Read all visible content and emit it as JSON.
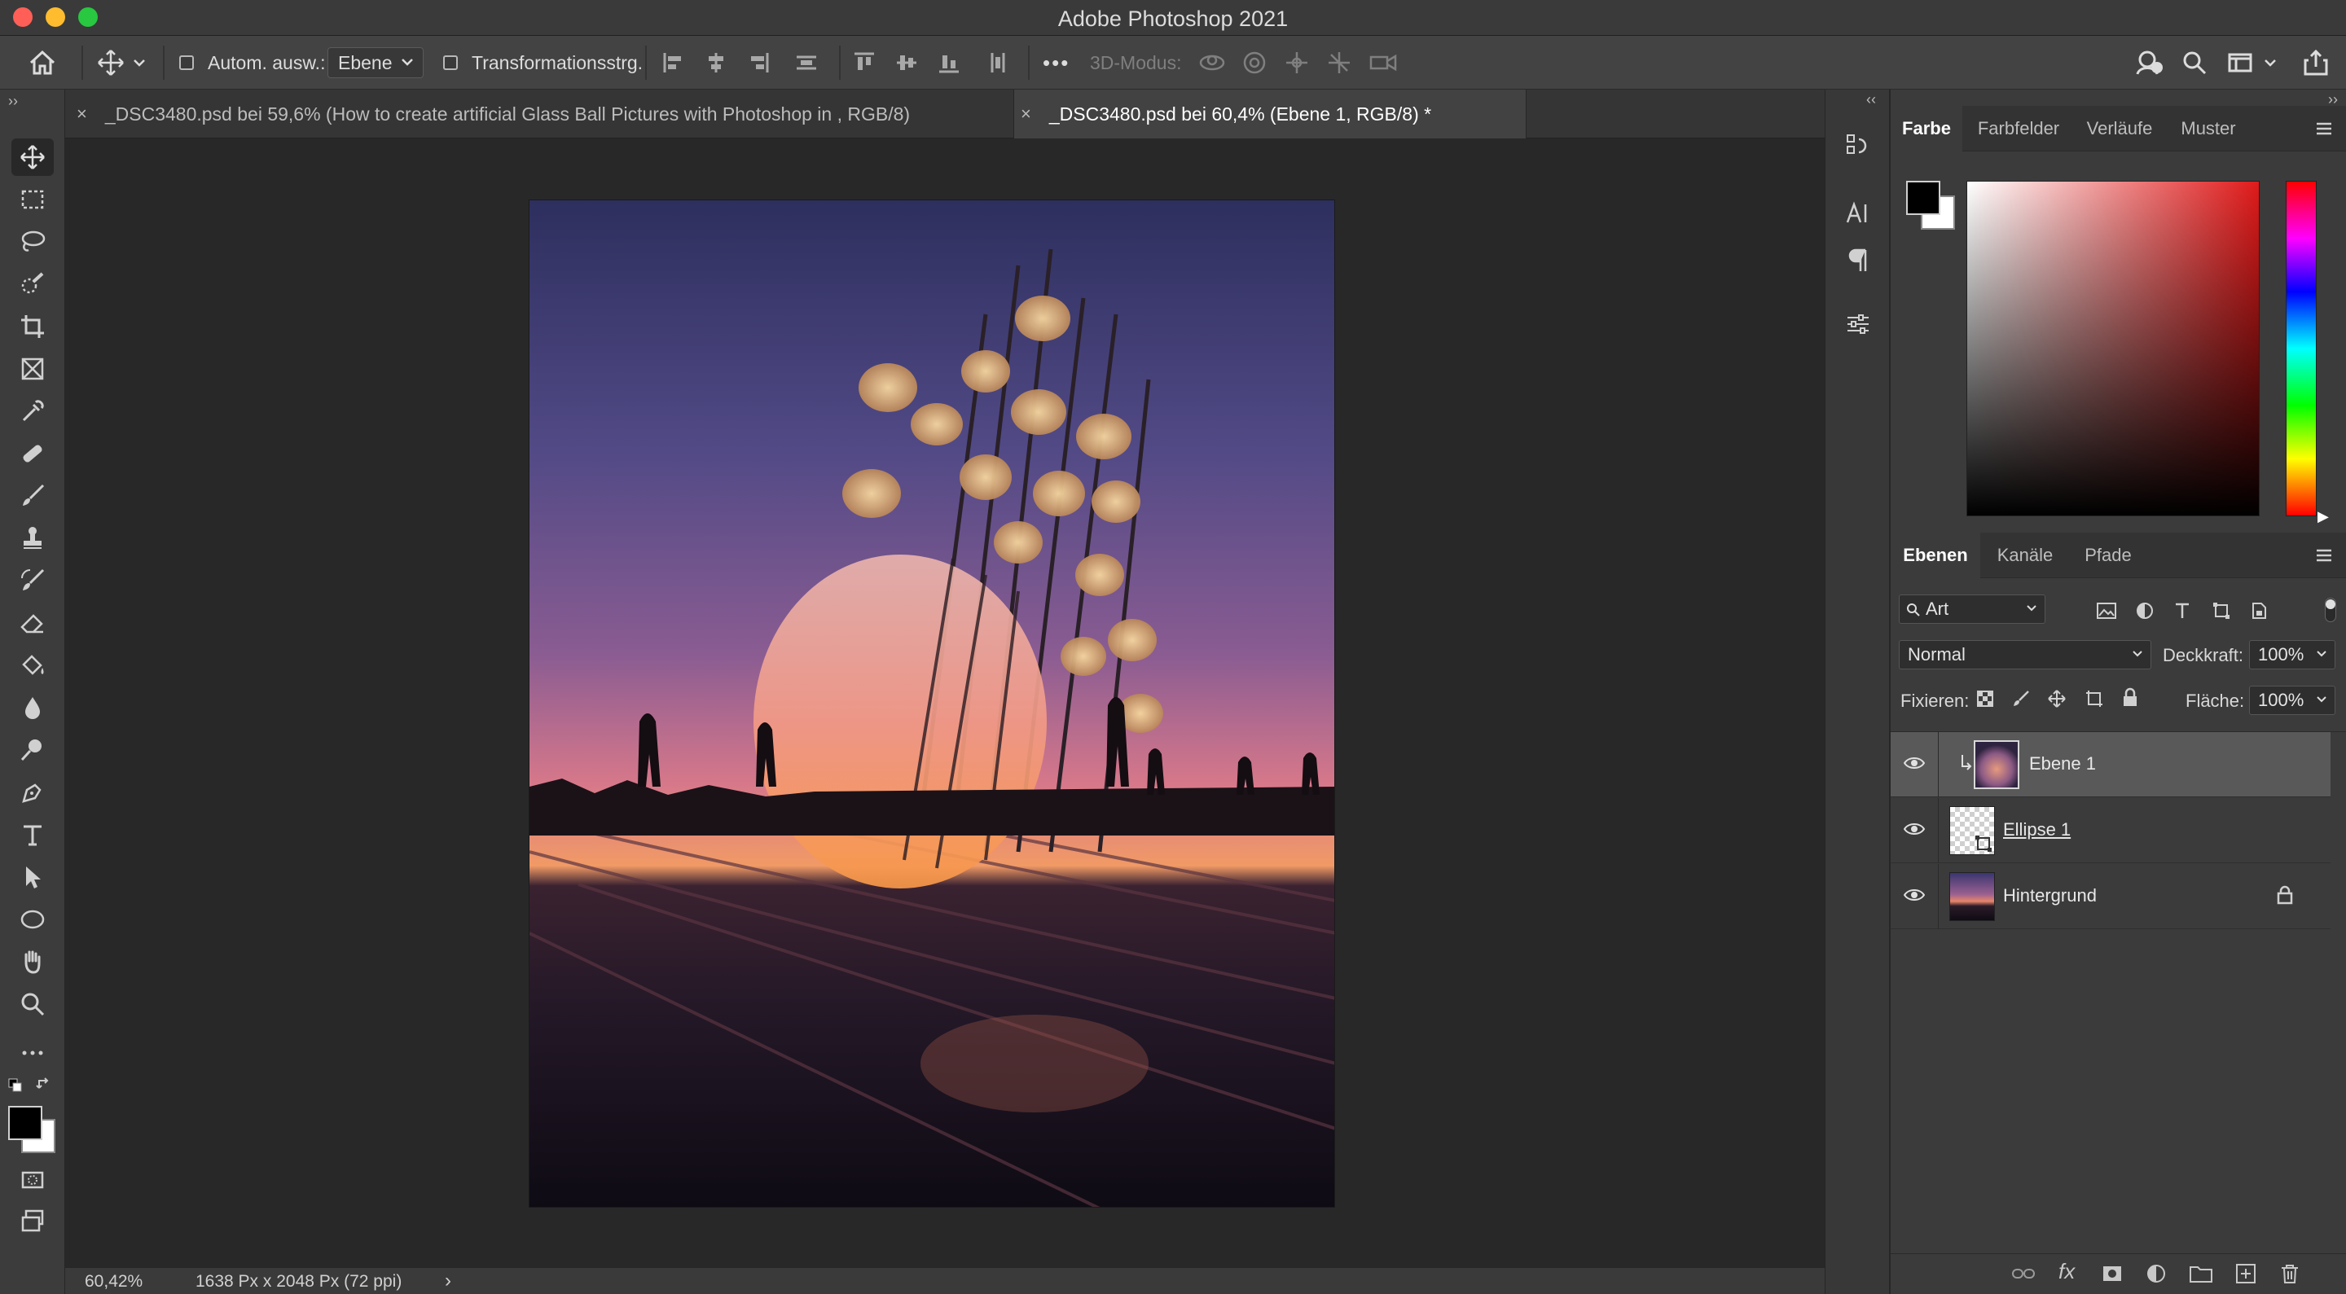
{
  "window": {
    "title": "Adobe Photoshop 2021"
  },
  "options_bar": {
    "auto_select_label": "Autom. ausw.:",
    "auto_select_target": "Ebene",
    "transform_label": "Transformationsstrg.",
    "more": "•••",
    "mode_3d_label": "3D-Modus:"
  },
  "document_tabs": [
    {
      "label": "_DSC3480.psd bei 59,6% (How to create artificial Glass Ball Pictures with Photoshop in , RGB/8)",
      "close": "×",
      "active": false
    },
    {
      "label": "_DSC3480.psd bei 60,4% (Ebene 1, RGB/8) *",
      "close": "×",
      "active": true
    }
  ],
  "tools": [
    {
      "name": "move-tool",
      "icon": "move-icon",
      "active": true
    },
    {
      "name": "marquee-tool",
      "icon": "rect-marquee-icon"
    },
    {
      "name": "lasso-tool",
      "icon": "lasso-icon"
    },
    {
      "name": "quick-select-tool",
      "icon": "quick-select-icon"
    },
    {
      "name": "crop-tool",
      "icon": "crop-icon"
    },
    {
      "name": "frame-tool",
      "icon": "frame-icon"
    },
    {
      "name": "eyedropper-tool",
      "icon": "eyedropper-icon"
    },
    {
      "name": "healing-tool",
      "icon": "bandage-icon"
    },
    {
      "name": "brush-tool",
      "icon": "brush-icon"
    },
    {
      "name": "stamp-tool",
      "icon": "stamp-icon"
    },
    {
      "name": "history-brush-tool",
      "icon": "history-brush-icon"
    },
    {
      "name": "eraser-tool",
      "icon": "eraser-icon"
    },
    {
      "name": "paint-bucket-tool",
      "icon": "paint-bucket-icon"
    },
    {
      "name": "blur-tool",
      "icon": "drop-icon"
    },
    {
      "name": "dodge-tool",
      "icon": "dodge-icon"
    },
    {
      "name": "pen-tool",
      "icon": "pen-icon"
    },
    {
      "name": "type-tool",
      "icon": "type-icon"
    },
    {
      "name": "path-select-tool",
      "icon": "arrow-icon"
    },
    {
      "name": "ellipse-tool",
      "icon": "ellipse-icon"
    },
    {
      "name": "hand-tool",
      "icon": "hand-icon"
    },
    {
      "name": "zoom-tool",
      "icon": "magnifier-icon"
    },
    {
      "name": "more-tools",
      "icon": "ellipsis-icon"
    }
  ],
  "colors": {
    "foreground": "#000000",
    "background": "#ffffff",
    "accent_bg": "#282828"
  },
  "color_panel": {
    "tabs": [
      {
        "label": "Farbe",
        "active": true
      },
      {
        "label": "Farbfelder",
        "active": false
      },
      {
        "label": "Verläufe",
        "active": false
      },
      {
        "label": "Muster",
        "active": false
      }
    ]
  },
  "layers_panel": {
    "tabs": [
      {
        "label": "Ebenen",
        "active": true
      },
      {
        "label": "Kanäle",
        "active": false
      },
      {
        "label": "Pfade",
        "active": false
      }
    ],
    "filter_kind": "Art",
    "blend_mode": "Normal",
    "opacity_label": "Deckkraft:",
    "opacity_value": "100%",
    "lock_label": "Fixieren:",
    "fill_label": "Fläche:",
    "fill_value": "100%",
    "layers": [
      {
        "name": "Ebene 1",
        "selected": true,
        "visible": true,
        "clipped": true
      },
      {
        "name": "Ellipse 1",
        "selected": false,
        "visible": true,
        "underlined": true
      },
      {
        "name": "Hintergrund",
        "selected": false,
        "visible": true,
        "locked": true
      }
    ]
  },
  "status_bar": {
    "zoom": "60,42%",
    "doc_size": "1638 Px x 2048 Px (72 ppi)",
    "arrow": "›"
  }
}
